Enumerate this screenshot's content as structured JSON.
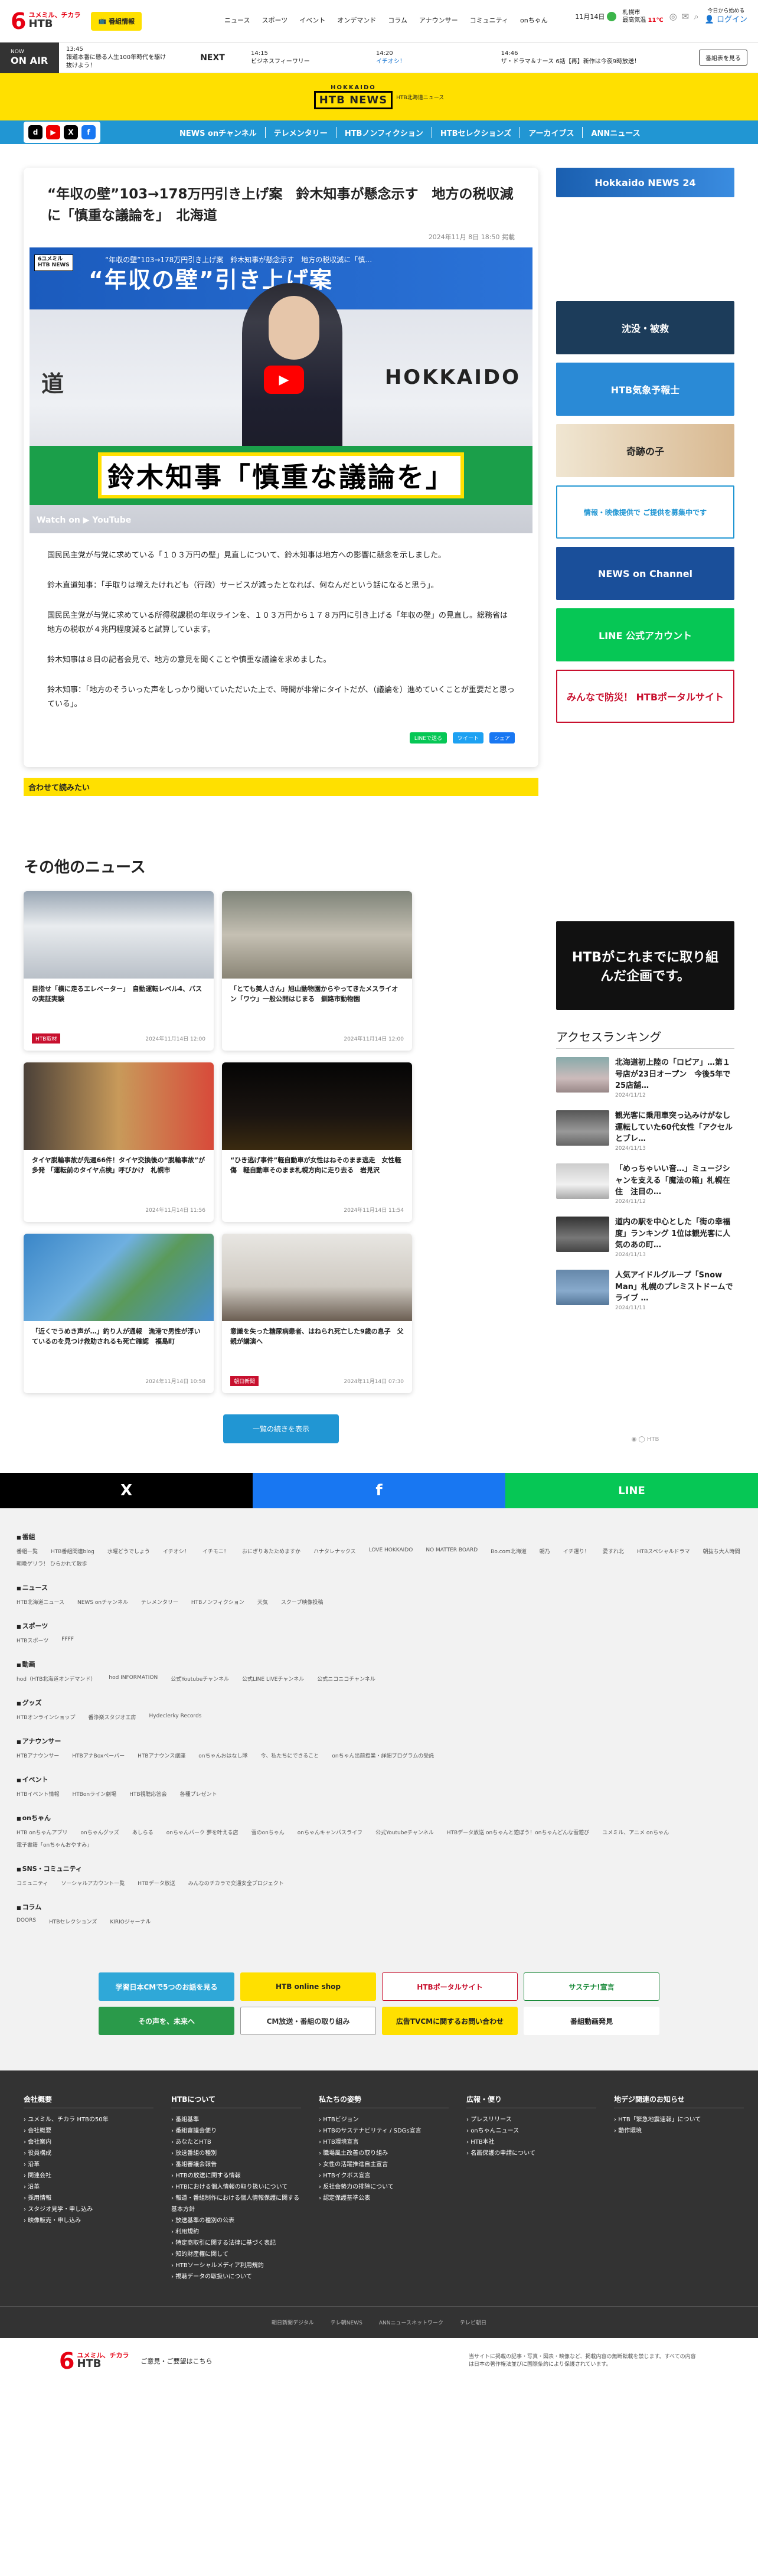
{
  "header": {
    "logo_number": "6",
    "logo_tagline": "ユメミル、チカラ",
    "logo_brand": "HTB",
    "register_button": "番組情報",
    "nav": [
      "ニュース",
      "スポーツ",
      "イベント",
      "オンデマンド",
      "コラム",
      "アナウンサー",
      "コミュニティ",
      "onちゃん"
    ],
    "date": "11月14日",
    "weather_city": "札幌市",
    "weather_label": "最高気温",
    "weather_temp": "11℃",
    "user_links": [
      "今日から始める",
      "ログイン"
    ],
    "user_sub": "ログイン"
  },
  "onair": {
    "badge_top": "NOW",
    "badge": "ON AIR",
    "now_time": "13:45",
    "now_title": "報道本番に懸る人生100年時代を駆け抜けよう！",
    "next_label": "NEXT",
    "schedule": [
      {
        "time": "14:15",
        "title": "ビジネスフィーワリー"
      },
      {
        "time": "14:20",
        "title": "イチオシ！"
      },
      {
        "time": "14:46",
        "title": "ザ・ドラマ＆ナース 6話【再】新作は今夜9時放送！"
      }
    ],
    "program_button": "番組表を見る"
  },
  "brand": {
    "top": "HOKKAIDO",
    "name": "HTB NEWS",
    "sub": "HTB北海道ニュース"
  },
  "sns": [
    "d",
    "▶",
    "X",
    "f"
  ],
  "mainnav": [
    "NEWS onチャンネル",
    "テレメンタリー",
    "HTBノンフィクション",
    "HTBセレクションズ",
    "アーカイブス",
    "ANNニュース"
  ],
  "article": {
    "title": "“年収の壁”103→178万円引き上げ案　鈴木知事が懸念示す　地方の税収減に「慎重な議論を」　北海道",
    "date": "2024年11月 8日 18:50 掲載",
    "video_title": "“年収の壁”103→178万円引き上げ案　鈴木知事が懸念示す　地方の税収減に「慎…",
    "video_banner": "“年収の壁”引き上げ案",
    "video_wall_left": "道",
    "video_wall_right": "HOKKAIDO",
    "video_caption": "鈴木知事「慎重な議論を」",
    "video_watch": "Watch on ▶ YouTube",
    "video_logo_top": "6ユメミル",
    "video_logo_bottom": "HTB NEWS",
    "paragraphs": [
      "国民民主党が与党に求めている「１０３万円の壁」見直しについて、鈴木知事は地方への影響に懸念を示しました。",
      "鈴木直道知事：「手取りは増えたけれども（行政）サービスが減ったとなれば、何なんだという話になると思う」。",
      "国民民主党が与党に求めている所得税課税の年収ラインを、１０３万円から１７８万円に引き上げる「年収の壁」の見直し。総務省は地方の税収が４兆円程度減ると試算しています。",
      "鈴木知事は８日の記者会見で、地方の意見を聞くことや慎重な議論を求めました。",
      "鈴木知事：「地方のそういった声をしっかり聞いていただいた上で、時間が非常にタイトだが、（議論を）進めていくことが重要だと思っている」。"
    ],
    "share": [
      "LINEで送る",
      "ツイート",
      "シェア"
    ],
    "related_label": "合わせて読みたい"
  },
  "other_news": {
    "heading": "その他のニュース",
    "cards": [
      {
        "title": "目指せ「横に走るエレベーター」　自動運転レベル4、バスの実証実験",
        "date": "2024年11月14日 12:00",
        "tag": "HTB取材"
      },
      {
        "title": "「とても美人さん」旭山動物園からやってきたメスライオン「ワウ」一般公開はじまる　釧路市動物園",
        "date": "2024年11月14日 12:00",
        "tag": ""
      },
      {
        "title": "タイヤ脱輪事故が先週66件！タイヤ交換後の“脱輪事故”が多発 「運転前のタイヤ点検」呼びかけ　札幌市",
        "date": "2024年11月14日 11:56",
        "tag": ""
      },
      {
        "title": "“ひき逃げ事件”軽自動車が女性はねそのまま逃走　女性軽傷　軽自動車そのまま札幌方向に走り去る　岩見沢",
        "date": "2024年11月14日 11:54",
        "tag": ""
      },
      {
        "title": "「近くでうめき声が…」釣り人が通報　漁港で男性が浮いているのを見つけ救助されるも死亡確認　福島町",
        "date": "2024年11月14日 10:58",
        "tag": ""
      },
      {
        "title": "意識を失った糖尿病患者、はねられ死亡した9歳の息子　父親が講演へ",
        "date": "2024年11月14日 07:30",
        "tag": "朝日新聞"
      }
    ],
    "more_button": "一覧の続きを表示"
  },
  "sidebar": {
    "banners": [
      "Hokkaido NEWS 24",
      "沈没・被救",
      "HTB気象予報士",
      "奇跡の子",
      "情報・映像提供で ご提供を募集中です",
      "NEWS on Channel",
      "LINE 公式アカウント",
      "みんなで防災！ HTBポータルサイト"
    ],
    "promo": "HTBがこれまでに取り組んだ企画です。",
    "ranking_title": "アクセスランキング",
    "ranking": [
      {
        "title": "北海道初上陸の「ロピア」…第１号店が23日オープン　今後5年で25店舗…",
        "date": "2024/11/12"
      },
      {
        "title": "観光客に乗用車突っ込みけがなし　運転していた60代女性「アクセルとブレ…",
        "date": "2024/11/13"
      },
      {
        "title": "「めっちゃいい音…」ミュージシャンを支える「魔法の箱」札幌在住　注目の…",
        "date": "2024/11/12"
      },
      {
        "title": "道内の駅を中心とした「街の幸福度」ランキング 1位は観光客に人気のあの町…",
        "date": "2024/11/13"
      },
      {
        "title": "人気アイドルグループ「Snow Man」札幌のプレミストドームでライブ …",
        "date": "2024/11/11"
      }
    ],
    "tiny_logo": "◉ ◯ HTB"
  },
  "share_bar": [
    "X",
    "f",
    "LINE"
  ],
  "footer": {
    "sections": [
      {
        "title": "番組",
        "links": [
          "番組一覧",
          "HTB番組関連blog",
          "水曜どうでしょう",
          "イチオシ！",
          "イチモニ！",
          "おにぎりあたためますか",
          "ハナタレナックス",
          "LOVE HOKKAIDO",
          "NO MATTER BOARD",
          "Bo.com北海道",
          "朝乃",
          "イチ選り！",
          "愛すれ北",
          "HTBスペシャルドラマ",
          "朝抜ち大人時間",
          "朝晩ゲリラ！ ひらかれて散歩"
        ]
      },
      {
        "title": "ニュース",
        "links": [
          "HTB北海道ニュース",
          "NEWS onチャンネル",
          "テレメンタリー",
          "HTBノンフィクション",
          "天気",
          "スクープ映像投稿"
        ]
      },
      {
        "title": "スポーツ",
        "links": [
          "HTBスポーツ",
          "FFFF"
        ]
      },
      {
        "title": "動画",
        "links": [
          "hod（HTB北海道オンデマンド）",
          "hod INFORMATION",
          "公式Youtubeチャンネル",
          "公式LINE LIVEチャンネル",
          "公式ニコニコチャンネル"
        ]
      },
      {
        "title": "グッズ",
        "links": [
          "HTBオンラインショップ",
          "番浄楽スタジオ工房",
          "Hydeclerky Records"
        ]
      },
      {
        "title": "アナウンサー",
        "links": [
          "HTBアナウンサー",
          "HTBアナBoxペーパー",
          "HTBアナウンス講座",
          "onちゃんおはなし隊",
          "今、私たちにできること",
          "onちゃん出前授業・詳細プログラムの受託"
        ]
      },
      {
        "title": "イベント",
        "links": [
          "HTBイベント情報",
          "HTBonライン劇場",
          "HTB視聴応答会",
          "各種プレゼント"
        ]
      },
      {
        "title": "onちゃん",
        "links": [
          "HTB onちゃんアプリ",
          "onちゃんグッズ",
          "あしらる",
          "onちゃんパーク 夢を叶える店",
          "雪のonちゃん",
          "onちゃんキャンパスライフ",
          "公式Youtubeチャンネル",
          "HTBデータ放送 onちゃんと遊ぼう！onちゃんどんな雪遊び",
          "ユメミル、アニメ onちゃん",
          "電子書籍「onちゃんおやすみ」"
        ]
      },
      {
        "title": "SNS・コミュニティ",
        "links": [
          "コミュニティ",
          "ソーシャルアカウント一覧",
          "HTBデータ放送",
          "みんなのチカラで交通安全プロジェクト"
        ]
      },
      {
        "title": "コラム",
        "links": [
          "DOORS",
          "HTBセレクションズ",
          "KIRIOジャーナル"
        ]
      }
    ],
    "ads": [
      "学習日本CMで5つのお話を見る",
      "HTB online shop",
      "HTBポータルサイト",
      "サステナ!宣言",
      "その声を、未来へ",
      "CM放送・番組の取り組み",
      "広告TVCMに関するお問い合わせ",
      "番組動画発見"
    ]
  },
  "company": {
    "cols": [
      {
        "title": "会社概要",
        "items": [
          "ユメミル、チカラ HTBの50年",
          "会社概要",
          "会社案内",
          "役員構成",
          "沿革",
          "関連会社",
          "沿革",
          "採用情報",
          "スタジオ見学・申し込み",
          "映像販売・申し込み"
        ]
      },
      {
        "title": "HTBについて",
        "items": [
          "番組基準",
          "番組審議会便り",
          "あなたとHTB",
          "放送番組の種別",
          "番組審議会報告",
          "HTBの放送に関する情報",
          "HTBにおける個人情報の取り扱いについて",
          "報道・番組制作における個人情報保護に関する基本方針",
          "放送基準の種別の公表",
          "利用規約",
          "特定商取引に関する法律に基づく表記",
          "知的財産権に関して",
          "HTBソーシャルメディア利用規約",
          "視聴データの取扱いについて"
        ]
      },
      {
        "title": "私たちの姿勢",
        "items": [
          "HTBビジョン",
          "HTBのサステナビリティ / SDGs宣言",
          "HTB環境宣言",
          "職場風土改善の取り組み",
          "女性の活躍推進自主宣言",
          "HTBイクボス宣言",
          "反社会勢力の排除について",
          "認定保護基準公表"
        ]
      },
      {
        "title": "広報・便り",
        "items": [
          "プレスリリース",
          "onちゃんニュース",
          "HTB本社",
          "名画保護の申請について"
        ]
      },
      {
        "title": "地デジ関連のお知らせ",
        "items": [
          "HTB「緊急地震速報」について",
          "動作環境",
          "",
          ""
        ]
      }
    ],
    "copyright_links": [
      "朝日新聞デジタル",
      "テレ朝NEWS",
      "ANNニュースネットワーク",
      "テレビ朝日"
    ],
    "bottom_links": [
      "ご意見・ご要望はこちら"
    ],
    "notice": "当サイトに掲載の記事・写真・図表・映像など、掲載内容の無断転載を禁じます。すべての内容は日本の著作権法並びに国際条約により保護されています。"
  }
}
